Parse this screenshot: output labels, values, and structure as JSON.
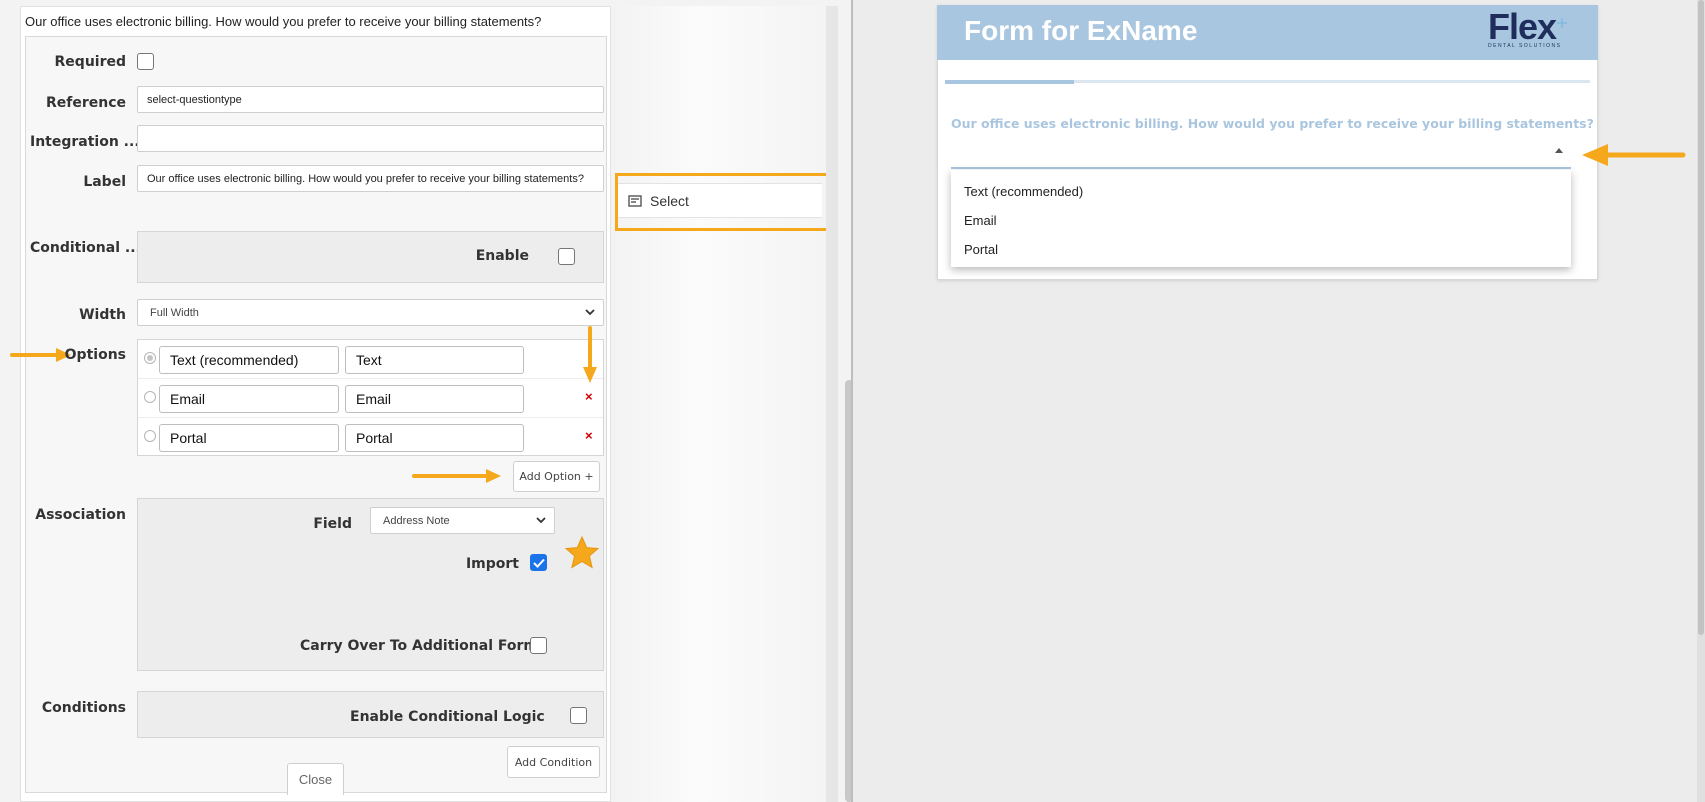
{
  "editor": {
    "title": "Our office uses electronic billing. How would you prefer to receive your billing statements?",
    "required_label": "Required",
    "reference_label": "Reference",
    "reference_value": "select-questiontype",
    "integration_label": "Integration ...",
    "integration_value": "",
    "label_label": "Label",
    "label_value": "Our office uses electronic billing. How would you prefer to receive your billing statements?",
    "conditional_label": "Conditional ...",
    "enable_label": "Enable",
    "width_label": "Width",
    "width_value": "Full Width",
    "options_label": "Options",
    "options": [
      {
        "label": "Text (recommended)",
        "value": "Text",
        "selected": true
      },
      {
        "label": "Email",
        "value": "Email",
        "selected": false
      },
      {
        "label": "Portal",
        "value": "Portal",
        "selected": false
      }
    ],
    "remove_symbol": "×",
    "add_option_label": "Add Option +",
    "association_label": "Association",
    "field_label": "Field",
    "field_value": "Address Note",
    "import_label": "Import",
    "import_checked": true,
    "carry_over_label": "Carry Over To Additional Forms",
    "conditions_label": "Conditions",
    "enable_logic_label": "Enable Conditional Logic",
    "add_condition_label": "Add Condition",
    "close_label": "Close"
  },
  "toolbox": {
    "select_label": "Select",
    "select_icon": "select-list-icon"
  },
  "preview": {
    "title": "Form for ExName",
    "logo_text": "Flex",
    "logo_subtitle": "DENTAL SOLUTIONS",
    "question": "Our office uses electronic billing. How would you prefer to receive your billing statements?",
    "progress_fraction": 0.2,
    "dropdown_options": [
      "Text (recommended)",
      "Email",
      "Portal"
    ]
  },
  "colors": {
    "accent_orange": "#f5a81c",
    "header_blue": "#a8c6df",
    "logo_navy": "#1f2d5c",
    "remove_red": "#d40000"
  }
}
